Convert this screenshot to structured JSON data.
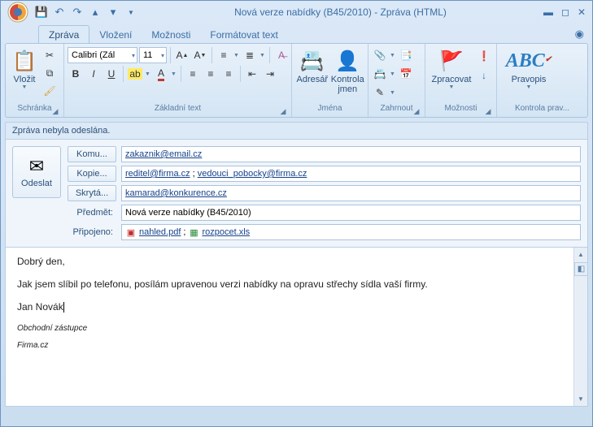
{
  "title": "Nová verze nabídky (B45/2010) - Zpráva (HTML)",
  "tabs": {
    "message": "Zpráva",
    "insert": "Vložení",
    "options": "Možnosti",
    "format": "Formátovat text"
  },
  "ribbon": {
    "clipboard": {
      "paste": "Vložit",
      "label": "Schránka"
    },
    "font": {
      "name": "Calibri (Zál",
      "size": "11",
      "label": "Základní text"
    },
    "names": {
      "addressbook": "Adresář",
      "checknames": "Kontrola\njmen",
      "label": "Jména"
    },
    "include": {
      "label": "Zahrnout"
    },
    "track": {
      "followup": "Zpracovat",
      "label": "Možnosti"
    },
    "proof": {
      "spelling": "Pravopis",
      "label": "Kontrola prav..."
    }
  },
  "msg": {
    "banner": "Zpráva nebyla odeslána.",
    "send": "Odeslat",
    "to_label": "Komu...",
    "cc_label": "Kopie...",
    "bcc_label": "Skrytá...",
    "subject_label": "Předmět:",
    "attach_label": "Připojeno:",
    "to": "zakaznik@email.cz",
    "cc1": "reditel@firma.cz",
    "cc2": "vedouci_pobocky@firma.cz",
    "bcc": "kamarad@konkurence.cz",
    "subject": "Nová verze nabídky (B45/2010)",
    "att1": "nahled.pdf",
    "att2": "rozpocet.xls",
    "body1": "Dobrý den,",
    "body2": "Jak jsem slíbil po telefonu, posílám upravenou verzi nabídky na opravu střechy sídla vaší firmy.",
    "body3": "Jan Novák",
    "sig1": "Obchodní zástupce",
    "sig2": "Firma.cz"
  }
}
